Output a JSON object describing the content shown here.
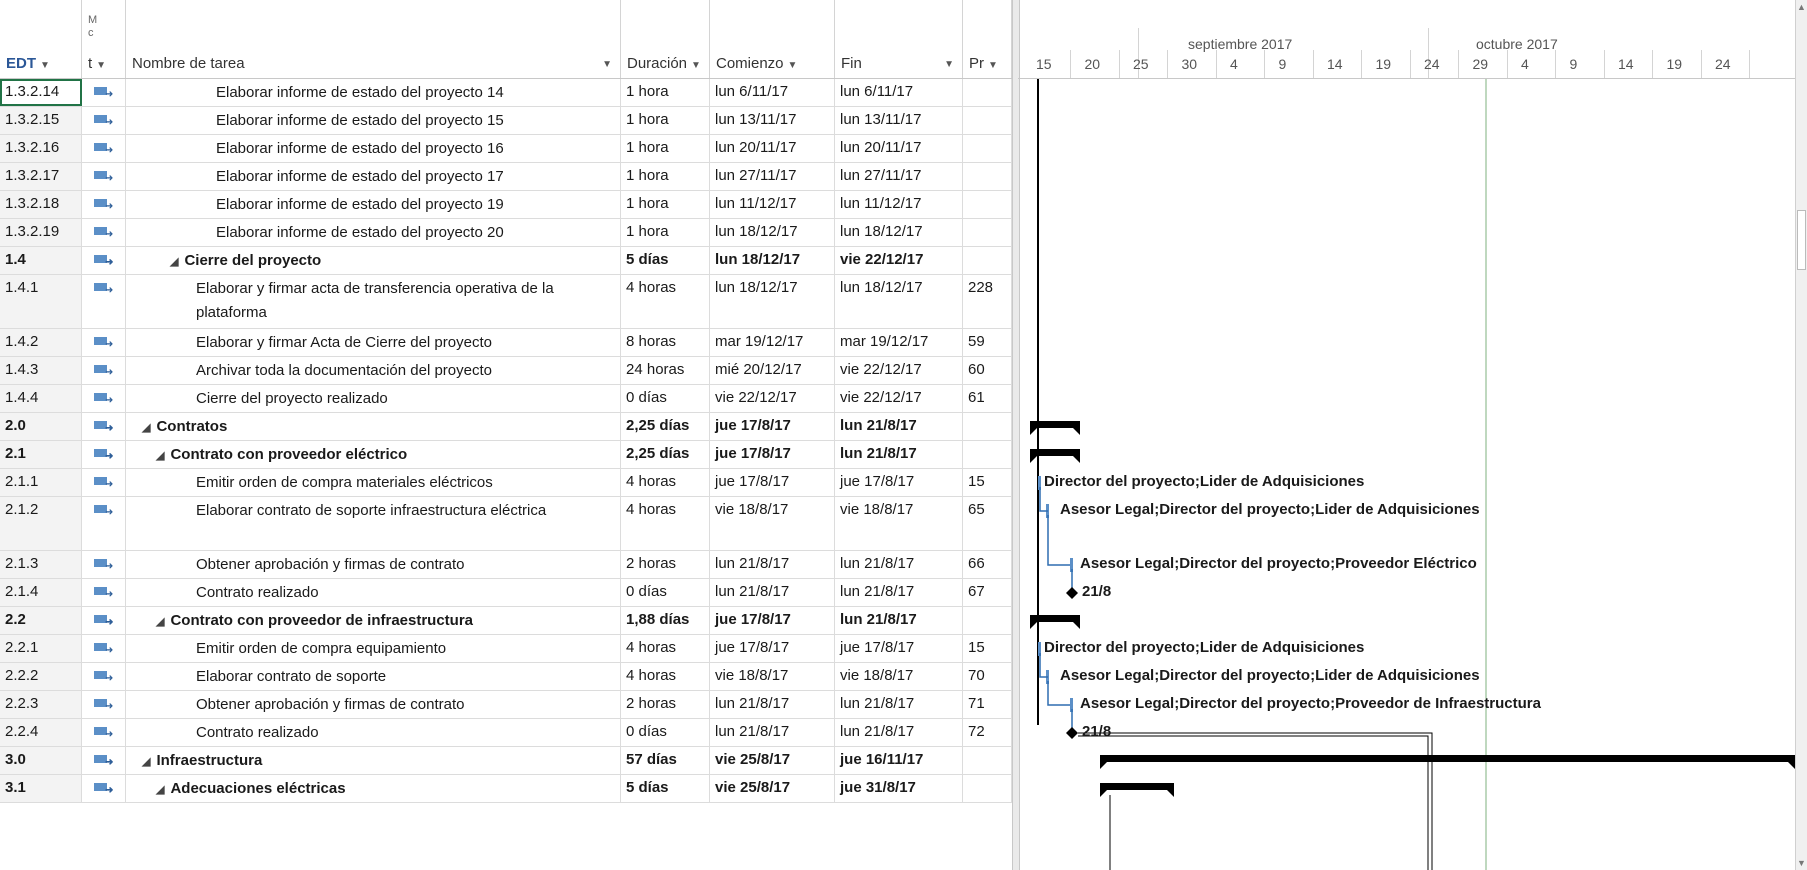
{
  "header": {
    "edt": "EDT",
    "mode": "Modo de tarea",
    "name": "Nombre de tarea",
    "duration": "Duración",
    "start": "Comienzo",
    "end": "Fin",
    "pred": "Pr"
  },
  "timeline": {
    "months": [
      "septiembre 2017",
      "octubre 2017"
    ],
    "days": [
      "15",
      "20",
      "25",
      "30",
      "4",
      "9",
      "14",
      "19",
      "24",
      "29",
      "4",
      "9",
      "14",
      "19",
      "24"
    ]
  },
  "rows": [
    {
      "edt": "1.3.2.14",
      "name": "Elaborar informe de estado del proyecto 14",
      "dur": "1 hora",
      "start": "lun 6/11/17",
      "end": "lun 6/11/17",
      "pred": ""
    },
    {
      "edt": "1.3.2.15",
      "name": "Elaborar informe de estado del proyecto 15",
      "dur": "1 hora",
      "start": "lun 13/11/17",
      "end": "lun 13/11/17",
      "pred": ""
    },
    {
      "edt": "1.3.2.16",
      "name": "Elaborar informe de estado del proyecto 16",
      "dur": "1 hora",
      "start": "lun 20/11/17",
      "end": "lun 20/11/17",
      "pred": ""
    },
    {
      "edt": "1.3.2.17",
      "name": "Elaborar informe de estado del proyecto 17",
      "dur": "1 hora",
      "start": "lun 27/11/17",
      "end": "lun 27/11/17",
      "pred": ""
    },
    {
      "edt": "1.3.2.18",
      "name": "Elaborar informe de estado del proyecto 19",
      "dur": "1 hora",
      "start": "lun 11/12/17",
      "end": "lun 11/12/17",
      "pred": ""
    },
    {
      "edt": "1.3.2.19",
      "name": "Elaborar informe de estado del proyecto 20",
      "dur": "1 hora",
      "start": "lun 18/12/17",
      "end": "lun 18/12/17",
      "pred": ""
    },
    {
      "edt": "1.4",
      "name": "Cierre del proyecto",
      "dur": "5 días",
      "start": "lun 18/12/17",
      "end": "vie 22/12/17",
      "pred": ""
    },
    {
      "edt": "1.4.1",
      "name": "Elaborar y firmar acta de transferencia operativa de la plataforma",
      "dur": "4 horas",
      "start": "lun 18/12/17",
      "end": "lun 18/12/17",
      "pred": "228"
    },
    {
      "edt": "1.4.2",
      "name": "Elaborar y firmar Acta de Cierre del proyecto",
      "dur": "8 horas",
      "start": "mar 19/12/17",
      "end": "mar 19/12/17",
      "pred": "59"
    },
    {
      "edt": "1.4.3",
      "name": "Archivar toda la documentación del proyecto",
      "dur": "24 horas",
      "start": "mié 20/12/17",
      "end": "vie 22/12/17",
      "pred": "60"
    },
    {
      "edt": "1.4.4",
      "name": "Cierre del proyecto realizado",
      "dur": "0 días",
      "start": "vie 22/12/17",
      "end": "vie 22/12/17",
      "pred": "61"
    },
    {
      "edt": "2.0",
      "name": "Contratos",
      "dur": "2,25 días",
      "start": "jue 17/8/17",
      "end": "lun 21/8/17",
      "pred": ""
    },
    {
      "edt": "2.1",
      "name": "Contrato con proveedor eléctrico",
      "dur": "2,25 días",
      "start": "jue 17/8/17",
      "end": "lun 21/8/17",
      "pred": ""
    },
    {
      "edt": "2.1.1",
      "name": "Emitir orden de compra materiales eléctricos",
      "dur": "4 horas",
      "start": "jue 17/8/17",
      "end": "jue 17/8/17",
      "pred": "15"
    },
    {
      "edt": "2.1.2",
      "name": "Elaborar contrato de soporte infraestructura eléctrica",
      "dur": "4 horas",
      "start": "vie 18/8/17",
      "end": "vie 18/8/17",
      "pred": "65"
    },
    {
      "edt": "2.1.3",
      "name": "Obtener aprobación y firmas de contrato",
      "dur": "2 horas",
      "start": "lun 21/8/17",
      "end": "lun 21/8/17",
      "pred": "66"
    },
    {
      "edt": "2.1.4",
      "name": "Contrato realizado",
      "dur": "0 días",
      "start": "lun 21/8/17",
      "end": "lun 21/8/17",
      "pred": "67"
    },
    {
      "edt": "2.2",
      "name": "Contrato con proveedor de infraestructura",
      "dur": "1,88 días",
      "start": "jue 17/8/17",
      "end": "lun 21/8/17",
      "pred": ""
    },
    {
      "edt": "2.2.1",
      "name": "Emitir orden de compra equipamiento",
      "dur": "4 horas",
      "start": "jue 17/8/17",
      "end": "jue 17/8/17",
      "pred": "15"
    },
    {
      "edt": "2.2.2",
      "name": "Elaborar contrato de soporte",
      "dur": "4 horas",
      "start": "vie 18/8/17",
      "end": "vie 18/8/17",
      "pred": "70"
    },
    {
      "edt": "2.2.3",
      "name": "Obtener aprobación y firmas de contrato",
      "dur": "2 horas",
      "start": "lun 21/8/17",
      "end": "lun 21/8/17",
      "pred": "71"
    },
    {
      "edt": "2.2.4",
      "name": "Contrato realizado",
      "dur": "0 días",
      "start": "lun 21/8/17",
      "end": "lun 21/8/17",
      "pred": "72"
    },
    {
      "edt": "3.0",
      "name": "Infraestructura",
      "dur": "57 días",
      "start": "vie 25/8/17",
      "end": "jue 16/11/17",
      "pred": ""
    },
    {
      "edt": "3.1",
      "name": "Adecuaciones eléctricas",
      "dur": "5 días",
      "start": "vie 25/8/17",
      "end": "jue 31/8/17",
      "pred": ""
    }
  ],
  "gantt_labels": {
    "r211": "Director del proyecto;Lider de Adquisiciones",
    "r212": "Asesor Legal;Director del proyecto;Lider de Adquisiciones",
    "r213": "Asesor Legal;Director del proyecto;Proveedor Eléctrico",
    "r214": "21/8",
    "r221": "Director del proyecto;Lider de Adquisiciones",
    "r222": "Asesor Legal;Director del proyecto;Lider de Adquisiciones",
    "r223": "Asesor Legal;Director del proyecto;Proveedor de Infraestructura",
    "r224": "21/8"
  },
  "colors": {
    "accent": "#217346",
    "task_icon": "#5b8fc7",
    "link": "#2f6db0"
  }
}
